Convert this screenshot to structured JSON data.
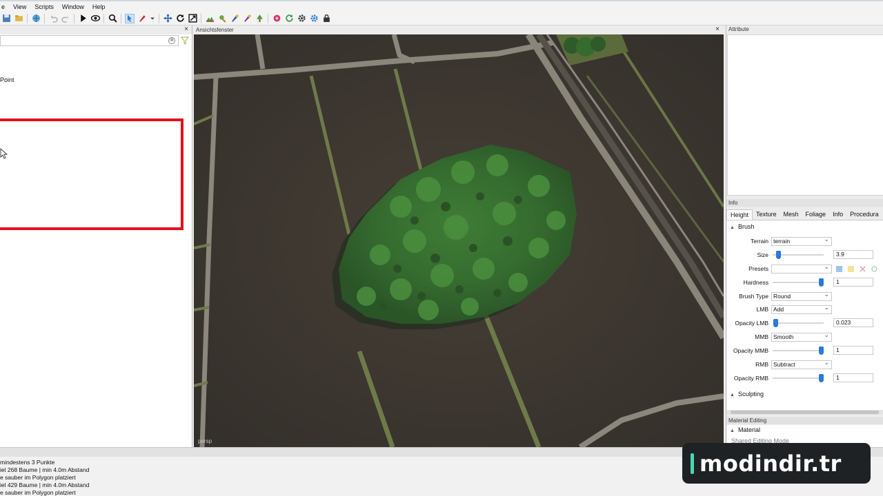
{
  "menu": [
    "e",
    "View",
    "Scripts",
    "Window",
    "Help"
  ],
  "left_panel": {
    "search_clear": "⊗",
    "item": "Point",
    "close": "×"
  },
  "viewport": {
    "title": "Ansichtsfenster",
    "camera": "persp",
    "close": "×"
  },
  "attribute_panel": {
    "title": "Attribute"
  },
  "info_panel": {
    "title": "Info",
    "tabs": [
      "Height",
      "Texture",
      "Mesh",
      "Foliage",
      "Info",
      "Procedura"
    ],
    "active_tab": "Height",
    "brush_section": "Brush",
    "sculpting_section": "Sculpting",
    "rows": {
      "terrain": {
        "label": "Terrain",
        "value": "terrain"
      },
      "size": {
        "label": "Size",
        "value": "3.9",
        "level": 0.07
      },
      "presets": {
        "label": "Presets",
        "value": ""
      },
      "hardness": {
        "label": "Hardness",
        "value": "1",
        "level": 1.0
      },
      "brush_type": {
        "label": "Brush Type",
        "value": "Round"
      },
      "lmb": {
        "label": "LMB",
        "value": "Add"
      },
      "opacity_lmb": {
        "label": "Opacity LMB",
        "value": "0.023",
        "level": 0.02
      },
      "mmb": {
        "label": "MMB",
        "value": "Smooth"
      },
      "opacity_mmb": {
        "label": "Opacity MMB",
        "value": "1",
        "level": 1.0
      },
      "rmb": {
        "label": "RMB",
        "value": "Subtract"
      },
      "opacity_rmb": {
        "label": "Opacity RMB",
        "value": "1",
        "level": 1.0
      }
    }
  },
  "material_panel": {
    "title": "Material Editing",
    "section": "Material",
    "sub": "Shared Editing Mode"
  },
  "console": [
    "mindestens 3 Punkte",
    "iel 268 Baume | min 4.0m Abstand",
    "e sauber im Polygon platziert",
    "iel 429 Baume | min 4.0m Abstand",
    "e sauber im Polygon platziert"
  ],
  "watermark": "modindir.tr",
  "colors": {
    "highlight": "#e5101c",
    "slider": "#2b79d8",
    "watermark_accent": "#47d7b2"
  }
}
